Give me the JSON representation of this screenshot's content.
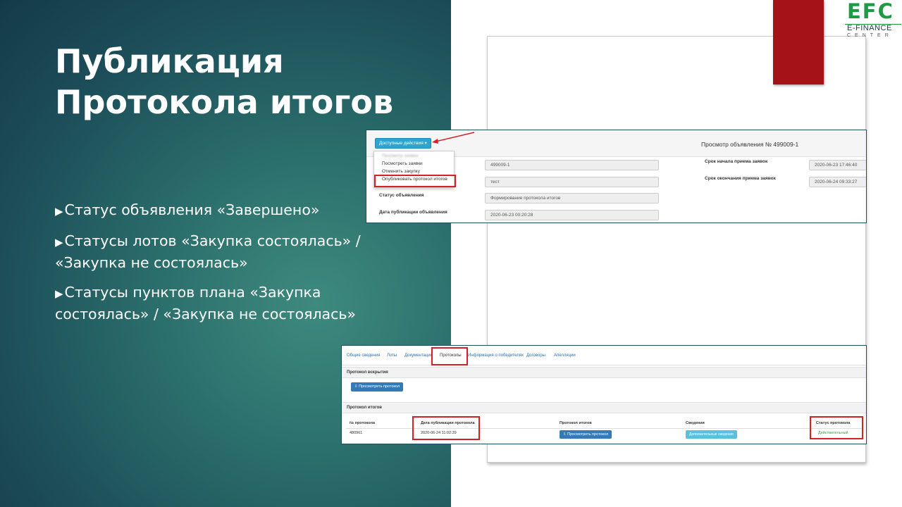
{
  "slide": {
    "title_line1": "Публикация",
    "title_line2": "Протокола итогов",
    "bullets": [
      "Статус объявления «Завершено»",
      "Статусы лотов «Закупка состоялась» / «Закупка не состоялась»",
      "Статусы пунктов плана «Закупка состоялась» / «Закупка не состоялась»"
    ]
  },
  "logo": {
    "mark": "EFC",
    "name": "E-FINANCE",
    "sub": "CENTER"
  },
  "announcement": {
    "actions_button": "Доступные действия ▾",
    "view_title": "Просмотр объявления № 499009-1",
    "menu_items": [
      "Просмотр заявки",
      "Посмотреть заявки",
      "Отменить закупку",
      "Опубликовать протокол итогов"
    ],
    "number_value": "499009-1",
    "name_value": "тест",
    "status_label": "Статус объявления",
    "status_value": "Формирование протокола итогов",
    "pub_date_label": "Дата публикации объявления",
    "pub_date_value": "2020-06-23 00:20:28",
    "start_label": "Срок начала приема заявок",
    "start_value": "2020-06-23 17:46:40",
    "end_label": "Срок окончания приема заявок",
    "end_value": "2020-06-24 09:33:27"
  },
  "protocols": {
    "tabs": [
      "Общие сведения",
      "Лоты",
      "Документация",
      "Протоколы",
      "Информация о победителях",
      "Договоры",
      "Апелляции"
    ],
    "opening_section": "Протокол вскрытия",
    "view_protocol_button": "Просмотреть протокол",
    "results_section": "Протокол итогов",
    "columns": [
      "№ протокола",
      "Дата публикации протокола",
      "Протокол итогов",
      "Сведения",
      "Статус протокола"
    ],
    "row": {
      "number": "480961",
      "date": "2020-06-24 11:02:39",
      "view_button": "Просмотреть протокол",
      "details_button": "Дополнительные сведения",
      "status": "Действительный"
    }
  },
  "colors": {
    "accent_red": "#d81f26",
    "brand_green": "#1e9a45",
    "status_green": "#3c9a3c"
  }
}
